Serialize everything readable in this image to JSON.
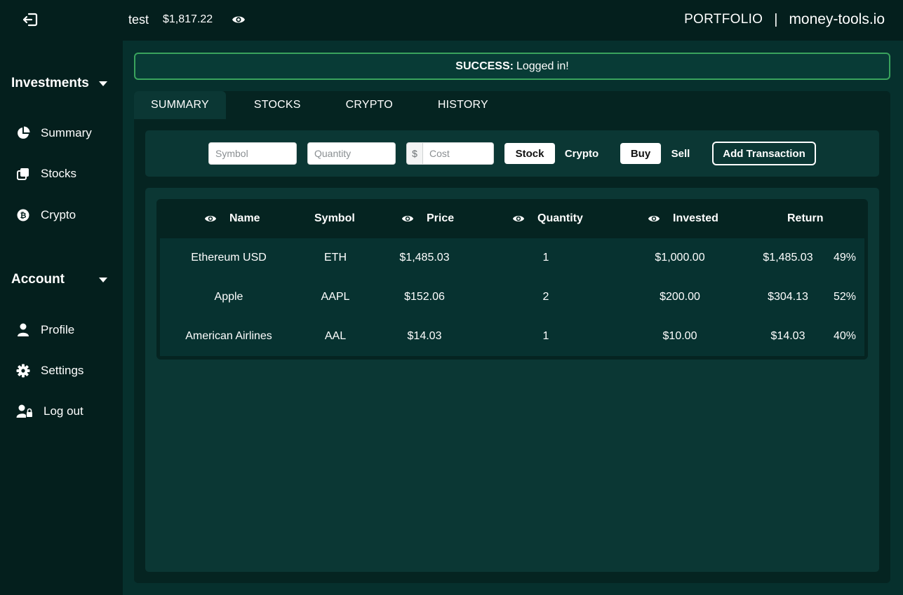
{
  "topbar": {
    "username": "test",
    "balance": "$1,817.22",
    "section": "PORTFOLIO",
    "separator": "|",
    "site": "money-tools.io"
  },
  "sidebar": {
    "groups": [
      {
        "label": "Investments",
        "items": [
          {
            "label": "Summary",
            "icon": "pie-chart-icon"
          },
          {
            "label": "Stocks",
            "icon": "copy-icon"
          },
          {
            "label": "Crypto",
            "icon": "bitcoin-icon"
          }
        ]
      },
      {
        "label": "Account",
        "items": [
          {
            "label": "Profile",
            "icon": "user-icon"
          },
          {
            "label": "Settings",
            "icon": "gear-icon"
          },
          {
            "label": "Log out",
            "icon": "user-lock-icon"
          }
        ]
      }
    ]
  },
  "alert": {
    "strong": "SUCCESS:",
    "text": "Logged in!"
  },
  "tabs": [
    "SUMMARY",
    "STOCKS",
    "CRYPTO",
    "HISTORY"
  ],
  "form": {
    "symbol_placeholder": "Symbol",
    "quantity_placeholder": "Quantity",
    "cost_prefix": "$",
    "cost_placeholder": "Cost",
    "type_options": [
      "Stock",
      "Crypto"
    ],
    "type_selected": "Stock",
    "side_options": [
      "Buy",
      "Sell"
    ],
    "side_selected": "Buy",
    "submit_label": "Add Transaction"
  },
  "table": {
    "headers": [
      "Name",
      "Symbol",
      "Price",
      "Quantity",
      "Invested",
      "Return"
    ],
    "rows": [
      {
        "name": "Ethereum USD",
        "symbol": "ETH",
        "price": "$1,485.03",
        "quantity": "1",
        "invested": "$1,000.00",
        "return_value": "$1,485.03",
        "return_pct": "49%"
      },
      {
        "name": "Apple",
        "symbol": "AAPL",
        "price": "$152.06",
        "quantity": "2",
        "invested": "$200.00",
        "return_value": "$304.13",
        "return_pct": "52%"
      },
      {
        "name": "American Airlines",
        "symbol": "AAL",
        "price": "$14.03",
        "quantity": "1",
        "invested": "$10.00",
        "return_value": "$14.03",
        "return_pct": "40%"
      }
    ]
  },
  "colors": {
    "background": "#052321",
    "panel": "#0b3734",
    "alert_border": "#3aa35d",
    "text": "#ffffff"
  }
}
